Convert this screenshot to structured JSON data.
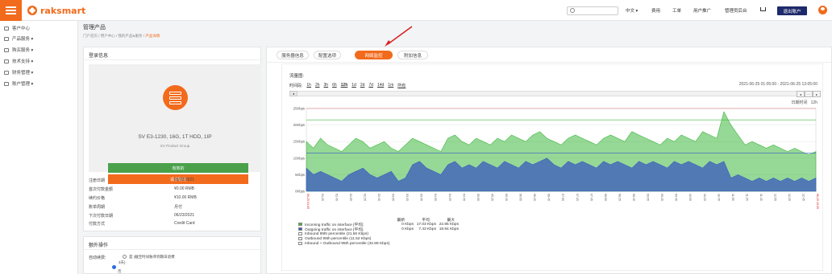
{
  "brand": {
    "name": "raksmart",
    "accent": "#f26a1b",
    "dark": "#1e2a6b"
  },
  "topnav": {
    "search_placeholder": "",
    "language": "中文 ▾",
    "items": [
      "费用",
      "工单",
      "用户推广",
      "管理员后台"
    ],
    "logout_label": "退出账户"
  },
  "sidebar": {
    "items": [
      {
        "label": "客户中心",
        "icon": "home-icon"
      },
      {
        "label": "产品服务 ▾",
        "icon": "server-icon"
      },
      {
        "label": "购买服务 ▾",
        "icon": "cart-icon"
      },
      {
        "label": "技术支持 ▾",
        "icon": "support-icon"
      },
      {
        "label": "财务管理 ▾",
        "icon": "wallet-icon"
      },
      {
        "label": "账户管理 ▾",
        "icon": "account-icon"
      }
    ]
  },
  "page": {
    "title": "管理产品",
    "breadcrumb": [
      "门户首页",
      "用户中心",
      "我的产品&服务",
      "产品详情"
    ]
  },
  "login_card": {
    "title": "登录信息",
    "product_name": "SV E3-1230, 16G, 1T HDD, 1IP",
    "product_group": "SV Product Group",
    "status_label": "有效的",
    "cancel_label": "请求取消",
    "rows": [
      {
        "k": "注册日期",
        "v": "05/23/2021"
      },
      {
        "k": "首次付款金额",
        "v": "¥0.00 RMB"
      },
      {
        "k": "续约价格",
        "v": "¥10.00 RMB"
      },
      {
        "k": "账单周期",
        "v": "月付"
      },
      {
        "k": "下次付款日期",
        "v": "06/23/2021"
      },
      {
        "k": "付款方式",
        "v": "Credit Card"
      }
    ]
  },
  "extra_card": {
    "title": "额外操作",
    "autorenew_label": "自动续费:",
    "opt_yes": "是 (截至时间账单到期日退费",
    "opt_yes2": "3天)",
    "opt_no": "否"
  },
  "tabs": [
    {
      "label": "服务器信息",
      "active": false
    },
    {
      "label": "配置选项",
      "active": false
    },
    {
      "label": "网络监控",
      "active": true
    },
    {
      "label": "附加信息",
      "active": false
    }
  ],
  "monitor": {
    "flow_label": "流量图:",
    "range_label": "时间段:",
    "ranges": [
      "1h",
      "2h",
      "3h",
      "6h",
      "12h",
      "1d",
      "2d",
      "7d",
      "14d",
      "1m",
      "所有"
    ],
    "date_range": "2021-06-25 01:05:00  -  2021-06-25 13:05:00",
    "since_label": "日期时间",
    "since_value": "12h",
    "nav_left": "◂",
    "nav_controls": [
      "◂",
      "··· ",
      "▸"
    ]
  },
  "chart_data": {
    "type": "area",
    "title": "",
    "xlabel": "",
    "ylabel": "",
    "ylim": [
      0,
      25
    ],
    "y_ticks": [
      "0Kbps",
      "5Kbps",
      "10Kbps",
      "15Kbps",
      "20Kbps",
      "25Kbps"
    ],
    "x_ticks": [
      "06-25 01:05",
      "01:15",
      "01:25",
      "01:35",
      "01:45",
      "01:55",
      "02:05",
      "02:15",
      "02:25",
      "02:35",
      "02:45",
      "02:55",
      "03:05",
      "03:15",
      "03:25",
      "03:35",
      "03:45",
      "03:55",
      "04:05",
      "04:15",
      "04:25",
      "04:35",
      "04:45",
      "04:55",
      "05:05",
      "05:15",
      "05:25",
      "05:35",
      "05:45",
      "05:55",
      "06:05",
      "06:15",
      "06:25",
      "06:35",
      "06:45",
      "06:55",
      "07:05",
      "07:15",
      "07:25",
      "07:35",
      "07:45",
      "07:55",
      "08:05",
      "08:15",
      "08:25",
      "08:35",
      "08:45",
      "08:55",
      "09:05",
      "09:15",
      "09:25",
      "09:35",
      "09:45",
      "09:55",
      "10:05",
      "10:15",
      "10:25",
      "10:35",
      "10:45",
      "10:55",
      "11:05",
      "11:15",
      "11:25",
      "11:35",
      "11:45",
      "11:55",
      "12:05",
      "12:15",
      "12:25",
      "12:35",
      "12:45",
      "12:55",
      "06-25 13:05"
    ],
    "series": [
      {
        "name": "Incoming traffic on interface",
        "color": "#3fb83f",
        "values": [
          15,
          13,
          16,
          14,
          13,
          12,
          14,
          16,
          15,
          13,
          14,
          15,
          13,
          12,
          14,
          16,
          15,
          14,
          13,
          12,
          16,
          17,
          15,
          14,
          16,
          15,
          14,
          16,
          15,
          17,
          16,
          15,
          17,
          18,
          16,
          15,
          14,
          16,
          17,
          16,
          15,
          14,
          16,
          17,
          16,
          15,
          18,
          17,
          16,
          15,
          14,
          16,
          15,
          17,
          16,
          15,
          18,
          17,
          16,
          24,
          20,
          17,
          14,
          15,
          14,
          13,
          14,
          13,
          12,
          13,
          12,
          11,
          12
        ]
      },
      {
        "name": "Outgoing traffic on interface",
        "color": "#3a5bbf",
        "values": [
          7,
          5,
          6,
          5,
          4,
          3,
          5,
          6,
          7,
          5,
          4,
          5,
          6,
          3,
          4,
          8,
          9,
          7,
          6,
          5,
          8,
          9,
          7,
          8,
          7,
          9,
          8,
          7,
          9,
          8,
          7,
          9,
          8,
          9,
          10,
          8,
          7,
          9,
          8,
          9,
          8,
          7,
          9,
          8,
          9,
          8,
          7,
          9,
          8,
          9,
          8,
          7,
          9,
          8,
          9,
          8,
          7,
          9,
          8,
          9,
          4,
          5,
          4,
          3,
          4,
          3,
          4,
          3,
          4,
          3,
          4,
          3,
          4
        ]
      }
    ],
    "reference_lines": [
      {
        "name": "Inbound 95th percentile",
        "value": 21.56,
        "color": "#3fb83f"
      },
      {
        "name": "Outbound 95th percentile",
        "value": 11.52,
        "color": "#3a5bbf"
      },
      {
        "name": "Inbound + Outbound 95th percentile",
        "value": 32.88,
        "color": "#e07070"
      }
    ],
    "legend_header": [
      "最新",
      "平均",
      "最大"
    ],
    "legend": [
      {
        "swatch": "#3fb83f",
        "name": "Incoming traffic on interface  [平均]",
        "last": "0 Kbps",
        "avg": "17.03 Kbps",
        "max": "22.85 Kbps"
      },
      {
        "swatch": "#3a5bbf",
        "name": "Outgoing traffic on interface  [平均]",
        "last": "0 Kbps",
        "avg": "7.43 Kbps",
        "max": "18.94 Kbps"
      },
      {
        "swatch": "#ffffff",
        "name": "Inbound 95th percentile (21.56 Kbps)",
        "last": "",
        "avg": "",
        "max": ""
      },
      {
        "swatch": "#ffffff",
        "name": "Outbound 95th percentile (11.52 Kbps)",
        "last": "",
        "avg": "",
        "max": ""
      },
      {
        "swatch": "#ffffff",
        "name": "Inbound + Outbound 95th percentile (32.88 Kbps)",
        "last": "",
        "avg": "",
        "max": ""
      }
    ]
  }
}
